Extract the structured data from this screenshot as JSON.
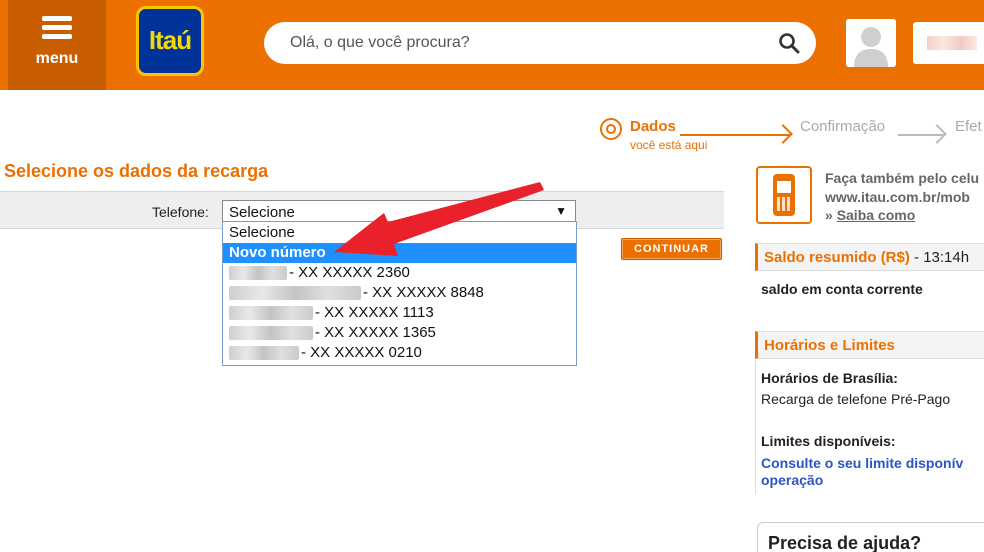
{
  "header": {
    "menu_label": "menu",
    "logo_text": "Itaú",
    "search_placeholder": "Olá, o que você procura?"
  },
  "stepper": {
    "step1": "Dados",
    "step1_sub": "você está aqui",
    "step2": "Confirmação",
    "step3": "Efet"
  },
  "form": {
    "title": "Selecione os dados da recarga",
    "phone_label": "Telefone:",
    "selected_value": "Selecione",
    "continue_label": "CONTINUAR",
    "options": [
      {
        "label": "Selecione"
      },
      {
        "label": "Novo número"
      },
      {
        "label": "- XX XXXXX 2360"
      },
      {
        "label": "- XX XXXXX 8848"
      },
      {
        "label": "- XX XXXXX 1113"
      },
      {
        "label": "- XX XXXXX 1365"
      },
      {
        "label": "- XX XXXXX 0210"
      }
    ]
  },
  "sidebar": {
    "promo_line1": "Faça também pelo celu",
    "promo_line2": "www.itau.com.br/mob",
    "promo_arrow": "»",
    "promo_link": "Saiba como",
    "saldo_title": "Saldo resumido (R$)",
    "saldo_time": " - 13:14h",
    "saldo_text": "saldo em conta corrente",
    "limits_title": "Horários e Limites",
    "hours_label": "Horários de Brasília:",
    "hours_value": "Recarga de telefone Pré-Pago",
    "limits_label": "Limites disponíveis:",
    "limits_link1": "Consulte o seu limite disponív",
    "limits_link2": "operação",
    "help_title": "Precisa de ajuda?"
  },
  "colors": {
    "brand_orange": "#ec7000",
    "highlight_blue": "#1e90ff",
    "link_blue": "#2a55c4",
    "annotation_red": "#e8212b"
  }
}
